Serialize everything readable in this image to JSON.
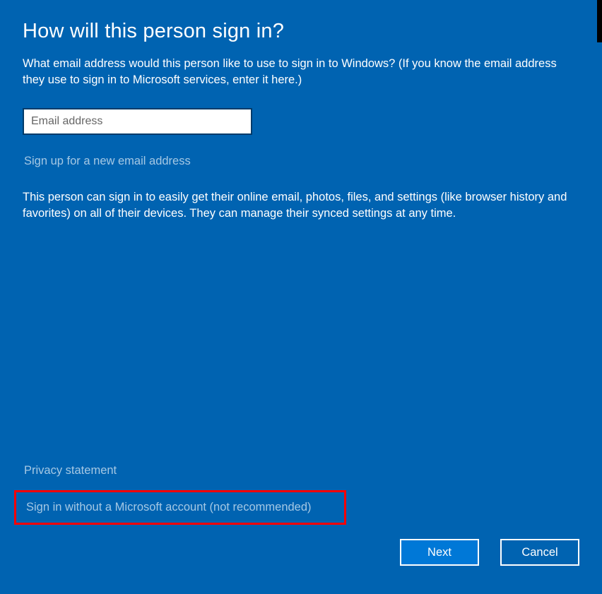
{
  "heading": "How will this person sign in?",
  "description": "What email address would this person like to use to sign in to Windows? (If you know the email address they use to sign in to Microsoft services, enter it here.)",
  "email_input": {
    "placeholder": "Email address",
    "value": ""
  },
  "signup_link": "Sign up for a new email address",
  "description2": "This person can sign in to easily get their online email, photos, files, and settings (like browser history and favorites) on all of their devices. They can manage their synced settings at any time.",
  "privacy_link": "Privacy statement",
  "no_account_link": "Sign in without a Microsoft account (not recommended)",
  "buttons": {
    "next": "Next",
    "cancel": "Cancel"
  }
}
